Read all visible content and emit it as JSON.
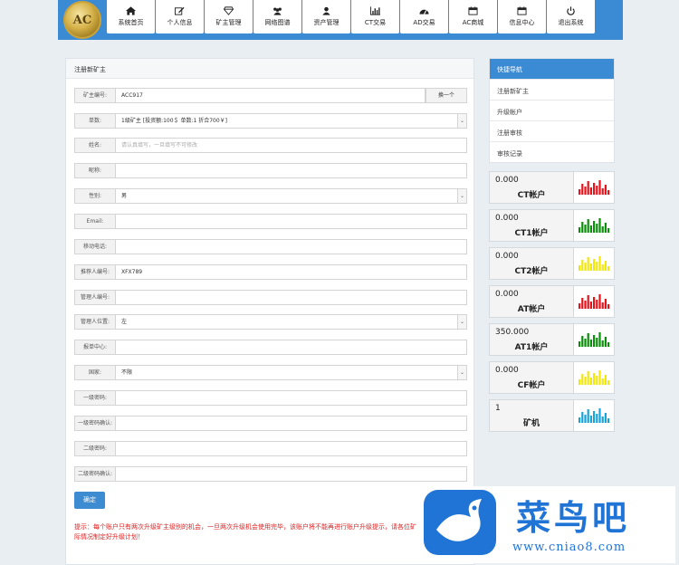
{
  "logo": {
    "text": "AC"
  },
  "nav": [
    {
      "label": "系统首页",
      "icon": "home-icon"
    },
    {
      "label": "个人信息",
      "icon": "edit-icon"
    },
    {
      "label": "矿主管理",
      "icon": "diamond-icon"
    },
    {
      "label": "网络图谱",
      "icon": "users-icon"
    },
    {
      "label": "资产管理",
      "icon": "user-icon"
    },
    {
      "label": "CT交易",
      "icon": "bar-chart-icon"
    },
    {
      "label": "AD交易",
      "icon": "dashboard-icon"
    },
    {
      "label": "AC商城",
      "icon": "calendar-icon"
    },
    {
      "label": "信息中心",
      "icon": "calendar-icon"
    },
    {
      "label": "退出系统",
      "icon": "power-icon"
    }
  ],
  "form": {
    "title": "注册新矿主",
    "fields": {
      "miner_id": {
        "label": "矿主编号:",
        "value": "ACC917"
      },
      "swap_button": "换一个",
      "plan": {
        "label": "单数:",
        "value": "1级矿主 [投资额:100＄ 单数:1 折合700￥]"
      },
      "name": {
        "label": "姓名:",
        "placeholder": "请认真填写，一旦填写不可修改"
      },
      "nickname": {
        "label": "昵称:"
      },
      "gender": {
        "label": "性别:",
        "value": "男"
      },
      "email": {
        "label": "Email:"
      },
      "mobile": {
        "label": "移动电话:"
      },
      "referrer": {
        "label": "推荐人编号:",
        "value": "XFX789"
      },
      "manager": {
        "label": "管理人编号:"
      },
      "position": {
        "label": "管理人位置:",
        "value": "左"
      },
      "center": {
        "label": "报单中心:"
      },
      "country": {
        "label": "国家:",
        "value": "不限"
      },
      "pwd1": {
        "label": "一级密码:"
      },
      "pwd1_confirm": {
        "label": "一级密码确认:"
      },
      "pwd2": {
        "label": "二级密码:"
      },
      "pwd2_confirm": {
        "label": "二级密码确认:"
      }
    },
    "submit": "确定",
    "tip": "提示：每个账户只有两次升级矿主级别的机会，一旦两次升级机会使用完毕，该账户将不能再进行账户升级提示，请各位矿主根据自身的实际情况制定好升级计划！"
  },
  "quick_nav": {
    "title": "快捷导航",
    "items": [
      "注册新矿主",
      "升级帐户",
      "注册审核",
      "审核记录"
    ]
  },
  "accounts": [
    {
      "value": "0.000",
      "name": "CT帐户",
      "color": "#e8121b"
    },
    {
      "value": "0.000",
      "name": "CT1帐户",
      "color": "#0b8f0b"
    },
    {
      "value": "0.000",
      "name": "CT2帐户",
      "color": "#f2e60c"
    },
    {
      "value": "0.000",
      "name": "AT帐户",
      "color": "#e8121b"
    },
    {
      "value": "350.000",
      "name": "AT1帐户",
      "color": "#0b8f0b"
    },
    {
      "value": "0.000",
      "name": "CF帐户",
      "color": "#f2e60c"
    },
    {
      "value": "1",
      "name": "矿机",
      "color": "#1aa3d8"
    }
  ],
  "watermark": {
    "title": "菜鸟吧",
    "url": "www.cniao8.com"
  }
}
